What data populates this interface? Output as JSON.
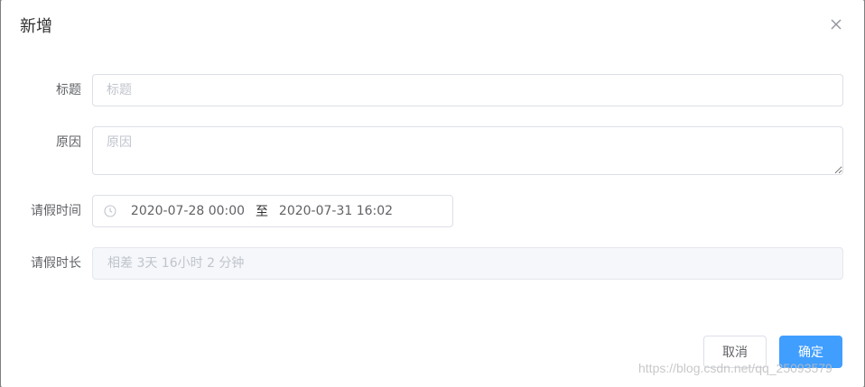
{
  "dialog": {
    "title": "新增",
    "close_icon": "close-icon"
  },
  "form": {
    "title_field": {
      "label": "标题",
      "placeholder": "标题",
      "value": ""
    },
    "reason_field": {
      "label": "原因",
      "placeholder": "原因",
      "value": ""
    },
    "leave_time": {
      "label": "请假时间",
      "icon": "clock-icon",
      "start": "2020-07-28 00:00",
      "separator": "至",
      "end": "2020-07-31 16:02"
    },
    "leave_duration": {
      "label": "请假时长",
      "value": "相差 3天 16小时 2 分钟"
    }
  },
  "footer": {
    "cancel_label": "取消",
    "confirm_label": "确定"
  },
  "watermark": "https://blog.csdn.net/qq_25093579",
  "colors": {
    "primary": "#409eff",
    "border": "#dcdfe6",
    "placeholder": "#c0c4cc",
    "disabled_bg": "#f5f7fa"
  }
}
